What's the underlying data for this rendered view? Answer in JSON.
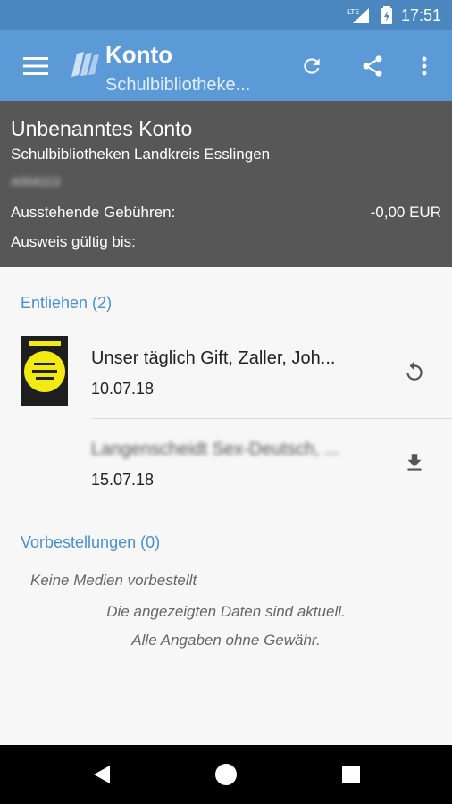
{
  "statusbar": {
    "network": "LTE",
    "time": "17:51"
  },
  "toolbar": {
    "title": "Konto",
    "subtitle": "Schulbibliotheke..."
  },
  "account": {
    "title": "Unbenanntes Konto",
    "library": "Schulbibliotheken Landkreis Esslingen",
    "id": "A004113",
    "fees_label": "Ausstehende Gebühren:",
    "fees_value": "-0,00 EUR",
    "valid_label": "Ausweis gültig bis:",
    "valid_value": ""
  },
  "lent": {
    "title": "Entliehen (2)",
    "items": [
      {
        "name": "Unser täglich Gift, Zaller, Joh...",
        "date": "10.07.18",
        "action": "renew-icon"
      },
      {
        "name": "Langenscheidt Sex-Deutsch, ...",
        "date": "15.07.18",
        "action": "download-icon"
      }
    ]
  },
  "reservations": {
    "title": "Vorbestellungen (0)",
    "empty": "Keine Medien vorbestellt"
  },
  "footer": {
    "line1": "Die angezeigten Daten sind aktuell.",
    "line2": "Alle Angaben ohne Gewähr."
  },
  "colors": {
    "toolbar": "#5b9ad6",
    "statusbar": "#4a87bf",
    "header": "#575757",
    "accent": "#4a8fce"
  }
}
